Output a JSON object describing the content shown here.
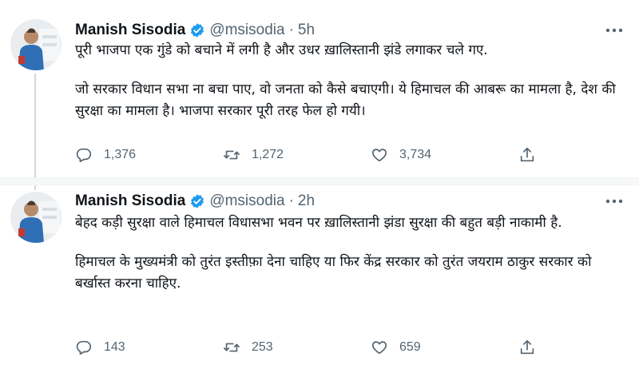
{
  "tweets": [
    {
      "author": {
        "name": "Manish Sisodia",
        "handle": "@msisodia"
      },
      "separator": "·",
      "time": "5h",
      "text": [
        "पूरी भाजपा एक गुंडे को बचाने में लगी है और उधर ख़ालिस्तानी झंडे लगाकर चले गए.",
        "जो सरकार विधान सभा ना बचा पाए, वो जनता को कैसे बचाएगी। ये हिमाचल की आबरू का मामला है, देश की सुरक्षा का मामला है। भाजपा सरकार पूरी तरह फेल हो गयी।"
      ],
      "replies": "1,376",
      "retweets": "1,272",
      "likes": "3,734"
    },
    {
      "author": {
        "name": "Manish Sisodia",
        "handle": "@msisodia"
      },
      "separator": "·",
      "time": "2h",
      "text": [
        "बेहद कड़ी सुरक्षा वाले हिमाचल विधासभा भवन पर ख़ालिस्तानी झंडा सुरक्षा की बहुत बड़ी नाकामी है.",
        "हिमाचल के मुख्यमंत्री को तुरंत इस्तीफ़ा देना चाहिए या फिर केंद्र सरकार को तुरंत जयराम ठाकुर सरकार को बर्खास्त करना चाहिए."
      ],
      "replies": "143",
      "retweets": "253",
      "likes": "659"
    }
  ],
  "icons": {
    "verified": "verified-badge-icon",
    "more": "more-options-icon",
    "reply": "reply-icon",
    "retweet": "retweet-icon",
    "like": "like-icon",
    "share": "share-icon"
  },
  "colors": {
    "verified": "#1d9bf0",
    "icon_gray": "#536471",
    "text": "#0f1419"
  }
}
